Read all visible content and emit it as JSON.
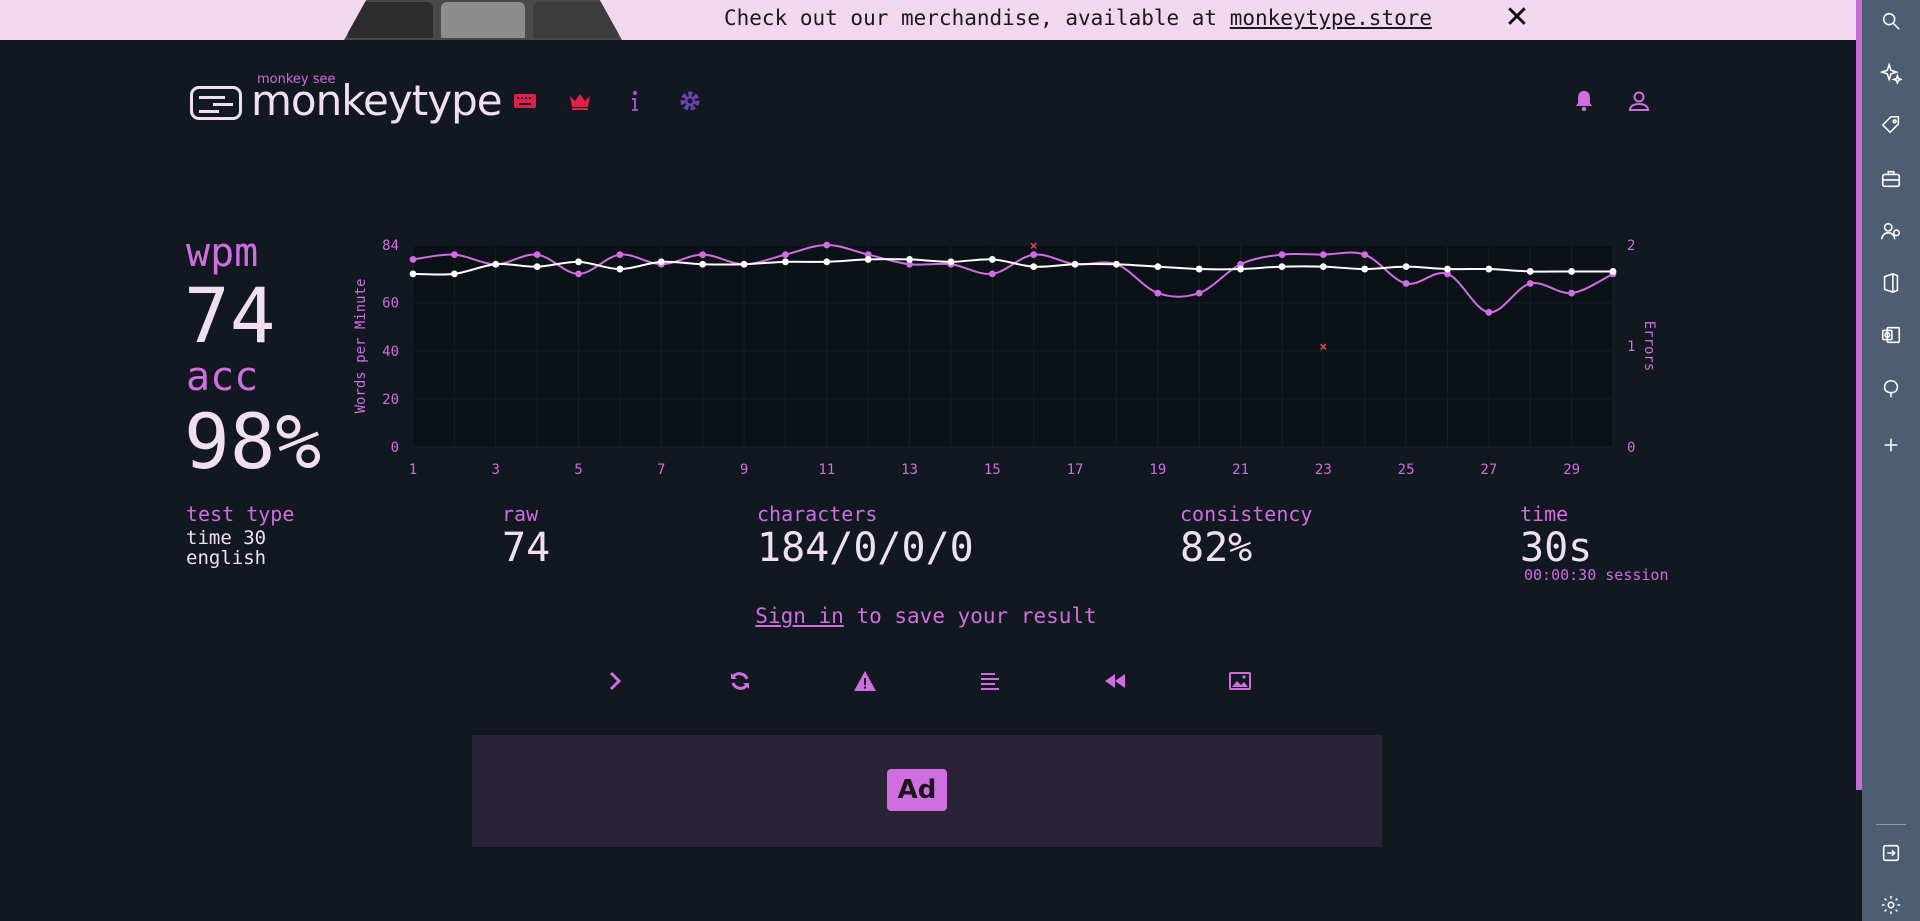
{
  "banner": {
    "text_prefix": "Check out our merchandise, available at ",
    "link_text": "monkeytype.store",
    "close_glyph": "✕"
  },
  "header": {
    "logo_small": "monkey see",
    "logo_text": "monkeytype",
    "nav": [
      {
        "name": "keyboard-icon",
        "color": "#e0204a"
      },
      {
        "name": "crown-icon",
        "color": "#e0204a"
      },
      {
        "name": "info-icon",
        "color": "#a050c0"
      },
      {
        "name": "gear-icon",
        "color": "#6a3fb0"
      }
    ],
    "right_icons": [
      "bell-icon",
      "user-icon"
    ]
  },
  "stats": {
    "wpm_label": "wpm",
    "wpm_value": "74",
    "acc_label": "acc",
    "acc_value": "98%",
    "test_type_label": "test type",
    "test_type_line1": "time 30",
    "test_type_line2": "english",
    "raw_label": "raw",
    "raw_value": "74",
    "characters_label": "characters",
    "characters_value": "184/0/0/0",
    "consistency_label": "consistency",
    "consistency_value": "82%",
    "time_label": "time",
    "time_value": "30s",
    "session": "00:00:30 session"
  },
  "signin": {
    "link": "Sign in",
    "rest": " to save your result"
  },
  "actions": [
    "next-test-icon",
    "restart-icon",
    "report-icon",
    "words-history-icon",
    "replay-icon",
    "screenshot-icon"
  ],
  "ad": {
    "label": "Ad"
  },
  "sidebar_icons": [
    "search-icon",
    "sparkle-icon",
    "tag-icon",
    "briefcase-icon",
    "people-icon",
    "office-icon",
    "outlook-icon",
    "tree-icon",
    "add-icon",
    "exit-icon",
    "settings-icon"
  ],
  "colors": {
    "accent": "#d06de0",
    "text": "#f0dff0",
    "background": "#111820",
    "error": "#e04050",
    "raw_line": "#ffffff"
  },
  "chart_data": {
    "type": "line",
    "ylabel": "Words per Minute",
    "y2label": "Errors",
    "ylim": [
      0,
      84
    ],
    "y2lim": [
      0,
      2
    ],
    "yticks": [
      "0",
      "20",
      "40",
      "60",
      "84"
    ],
    "y2ticks": [
      "0",
      "1",
      "2"
    ],
    "xticks": [
      "1",
      "3",
      "5",
      "7",
      "9",
      "11",
      "13",
      "15",
      "17",
      "19",
      "21",
      "23",
      "25",
      "27",
      "29"
    ],
    "x": [
      1,
      2,
      3,
      4,
      5,
      6,
      7,
      8,
      9,
      10,
      11,
      12,
      13,
      14,
      15,
      16,
      17,
      18,
      19,
      20,
      21,
      22,
      23,
      24,
      25,
      26,
      27,
      28,
      29,
      30
    ],
    "series": [
      {
        "color": "#d06de0",
        "values": [
          78,
          80,
          76,
          80,
          72,
          80,
          76,
          80,
          76,
          80,
          84,
          80,
          76,
          76,
          72,
          80,
          76,
          76,
          64,
          64,
          76,
          80,
          80,
          80,
          68,
          72,
          56,
          68,
          64,
          72
        ]
      },
      {
        "color": "#ffffff",
        "values": [
          72,
          72,
          76,
          75,
          77,
          74,
          77,
          76,
          76,
          77,
          77,
          78,
          78,
          77,
          78,
          75,
          76,
          76,
          75,
          74,
          74,
          75,
          75,
          74,
          75,
          74,
          74,
          73,
          73,
          73
        ]
      }
    ],
    "errors": [
      {
        "x": 16,
        "y": 2
      },
      {
        "x": 23,
        "y": 1
      }
    ]
  }
}
